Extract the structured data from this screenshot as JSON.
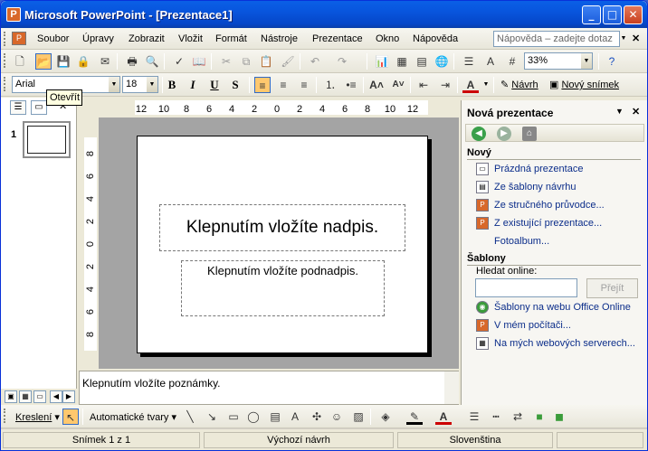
{
  "window": {
    "title": "Microsoft PowerPoint - [Prezentace1]"
  },
  "menu": {
    "items": [
      "Soubor",
      "Úpravy",
      "Zobrazit",
      "Vložit",
      "Formát",
      "Nástroje",
      "Prezentace",
      "Okno",
      "Nápověda"
    ],
    "help_placeholder": "Nápověda – zadejte dotaz"
  },
  "toolbar": {
    "zoom": "33%"
  },
  "formatting": {
    "font": "Arial",
    "size": "18",
    "bold": "B",
    "italic": "I",
    "underline": "U",
    "shadow": "S",
    "design_label": "Návrh",
    "new_slide_label": "Nový snímek"
  },
  "tooltip": "Otevřít",
  "slides_pane": {
    "slide_number": "1"
  },
  "ruler": {
    "horizontal": [
      "12",
      "10",
      "8",
      "6",
      "4",
      "2",
      "0",
      "2",
      "4",
      "6",
      "8",
      "10",
      "12"
    ],
    "vertical": [
      "8",
      "6",
      "4",
      "2",
      "0",
      "2",
      "4",
      "6",
      "8"
    ]
  },
  "slide": {
    "title_placeholder": "Klepnutím vložíte nadpis.",
    "subtitle_placeholder": "Klepnutím vložíte podnadpis."
  },
  "notes_placeholder": "Klepnutím vložíte poznámky.",
  "taskpane": {
    "title": "Nová prezentace",
    "new_section": "Nový",
    "new_links": [
      "Prázdná prezentace",
      "Ze šablony návrhu",
      "Ze stručného průvodce...",
      "Z existující prezentace...",
      "Fotoalbum..."
    ],
    "templates_section": "Šablony",
    "search_online_label": "Hledat online:",
    "go_button": "Přejít",
    "template_links": [
      "Šablony na webu Office Online",
      "V mém počítači...",
      "Na mých webových serverech..."
    ]
  },
  "drawing": {
    "draw_label": "Kreslení",
    "autoshapes_label": "Automatické tvary"
  },
  "status": {
    "slide": "Snímek 1 z 1",
    "design": "Výchozí návrh",
    "language": "Slovenština"
  }
}
